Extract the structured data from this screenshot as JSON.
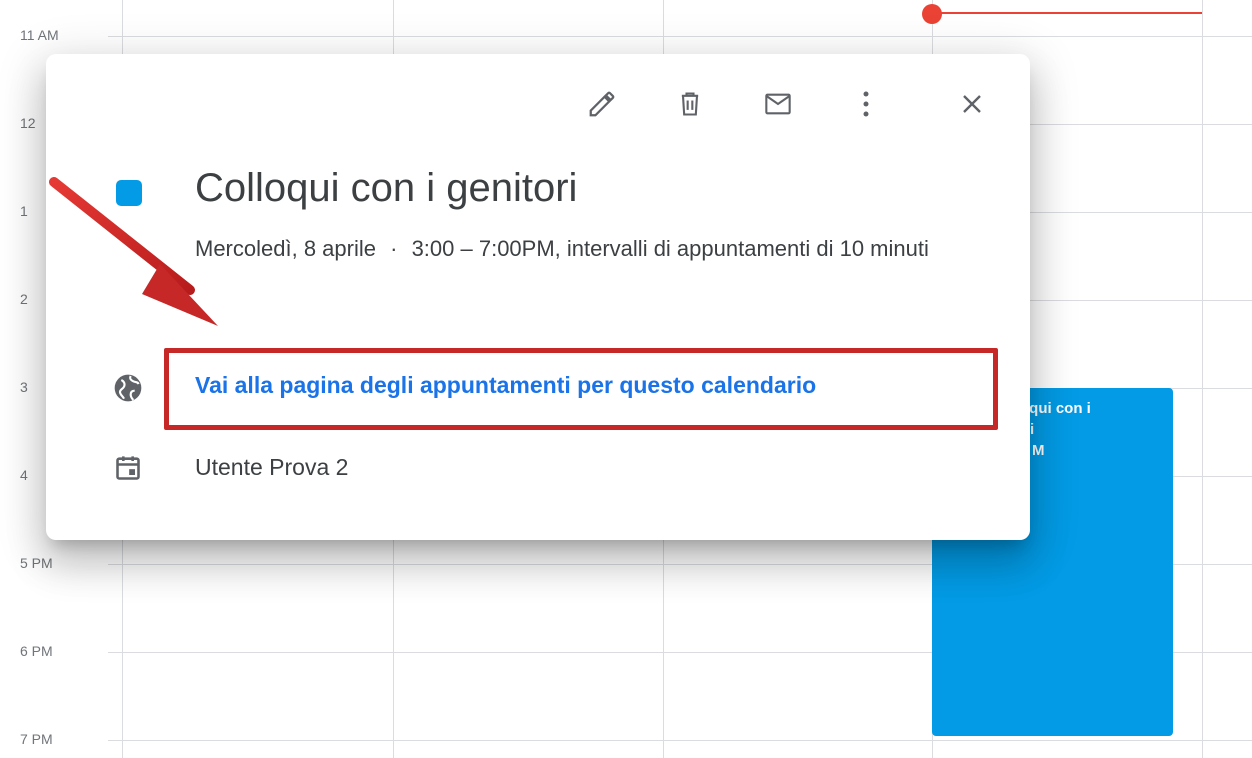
{
  "calendar": {
    "time_labels": [
      "11 AM",
      "12",
      "1",
      "2",
      "3",
      "4",
      "5 PM",
      "6 PM",
      "7 PM"
    ],
    "background_event": {
      "line1": "oqui con i",
      "line2": "i",
      "line3": "M",
      "color": "#039be5"
    },
    "now_indicator_color": "#ea4335"
  },
  "popup": {
    "toolbar": {
      "edit_icon": "pencil-icon",
      "delete_icon": "trash-icon",
      "email_icon": "envelope-icon",
      "more_icon": "more-vert-icon",
      "close_icon": "close-icon"
    },
    "event_color": "#039be5",
    "title": "Colloqui con i genitori",
    "subtitle_date": "Mercoledì, 8 aprile",
    "subtitle_separator": "·",
    "subtitle_time": "3:00 – 7:00PM, intervalli di appuntamenti di 10 minuti",
    "booking_link": "Vai alla pagina degli appuntamenti per questo calendario",
    "calendar_owner": "Utente Prova 2"
  },
  "annotation": {
    "highlight_color": "#c62828"
  }
}
